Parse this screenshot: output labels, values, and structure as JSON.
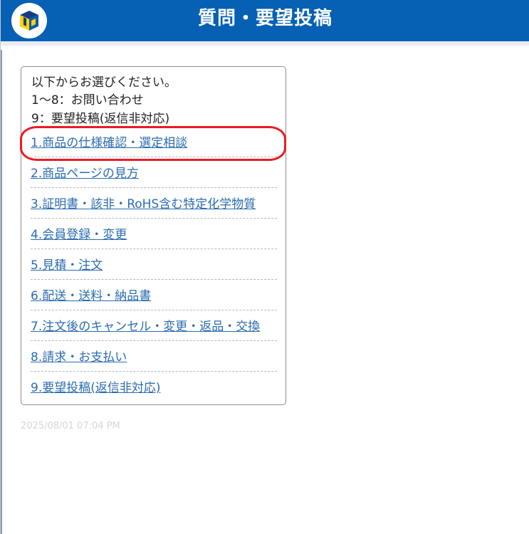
{
  "header": {
    "title": "質問・要望投稿",
    "logo_icon": "brand-logo-icon",
    "background_color": "#0660b4"
  },
  "menu_card": {
    "intro_lines": [
      "以下からお選びください。",
      "1～8：お問い合わせ",
      "9：要望投稿(返信非対応)"
    ],
    "items": [
      "1.商品の仕様確認・選定相談",
      "2.商品ページの見方",
      "3.証明書・該非・RoHS含む特定化学物質",
      "4.会員登録・変更",
      "5.見積・注文",
      "6.配送・送料・納品書",
      "7.注文後のキャンセル・変更・返品・交換",
      "8.請求・お支払い",
      "9.要望投稿(返信非対応)"
    ],
    "link_color": "#2b6cb0",
    "highlight_color": "#ea1c24"
  },
  "message": {
    "timestamp": "2025/08/01 07:04 PM"
  }
}
